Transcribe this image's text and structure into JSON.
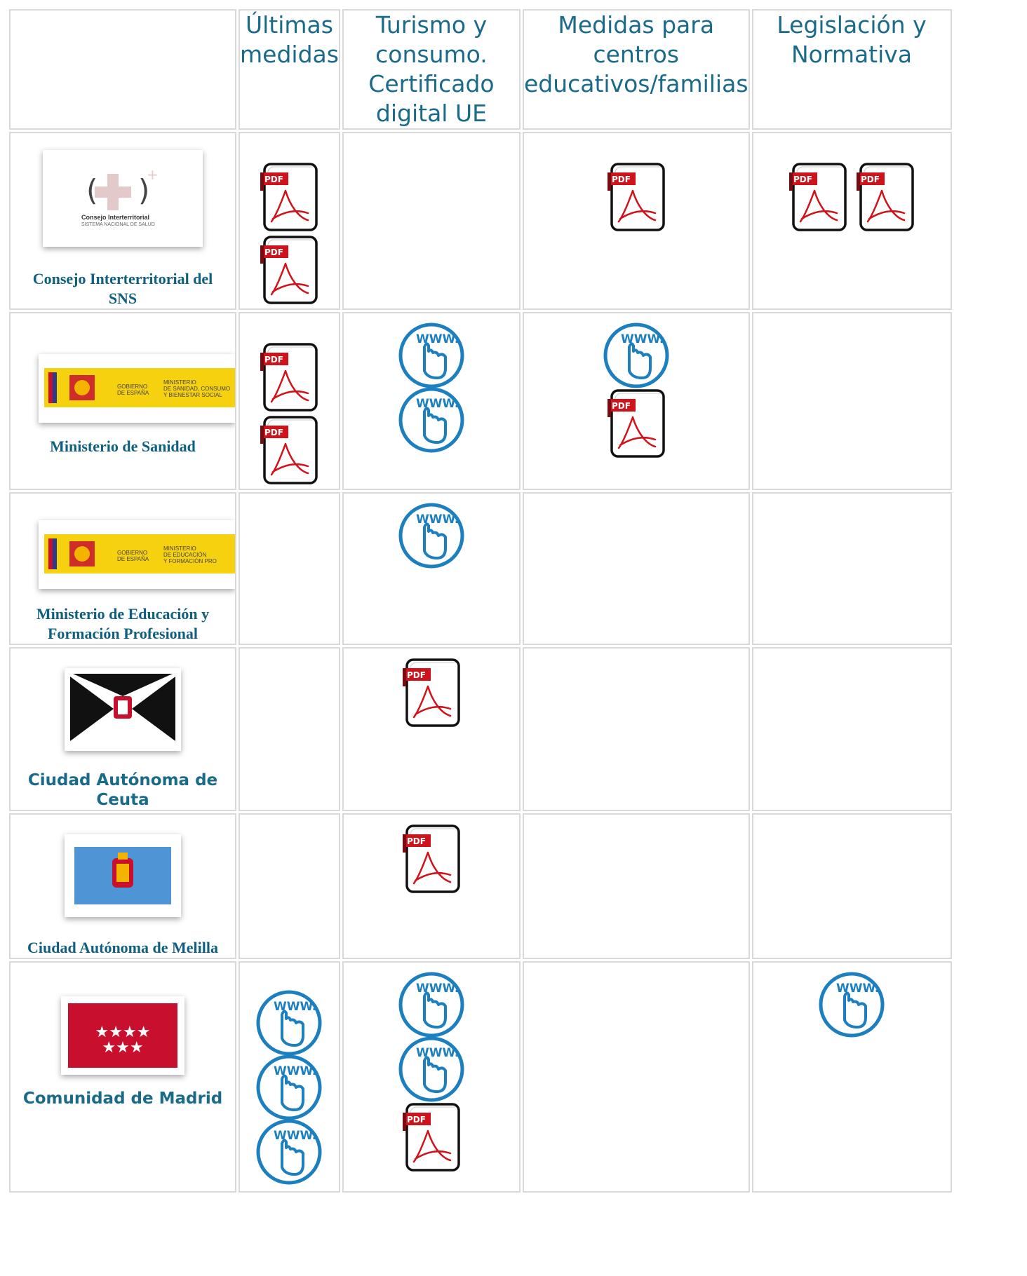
{
  "headers": [
    "Últimas medidas",
    "Turismo y consumo. Certificado digital UE",
    "Medidas para centros educativos/familias",
    "Legislación y Normativa"
  ],
  "icon_labels": {
    "pdf": "PDF",
    "www": "WWW."
  },
  "rows": [
    {
      "name": "Consejo Interterritorial del SNS",
      "logo": {
        "line1": "Consejo Interterritorial",
        "line2": "SISTEMA NACIONAL DE SALUD"
      },
      "cells": [
        [
          "pdf",
          "pdf"
        ],
        [],
        [
          "pdf"
        ],
        [
          "pdf",
          "pdf"
        ]
      ]
    },
    {
      "name": "Ministerio de Sanidad",
      "logo": {
        "gob": "GOBIERNO DE ESPAÑA",
        "min1": "MINISTERIO",
        "min2": "DE SANIDAD, CONSUMO",
        "min3": "Y BIENESTAR SOCIAL"
      },
      "cells": [
        [
          "pdf",
          "pdf"
        ],
        [
          "www",
          "www"
        ],
        [
          "www",
          "pdf"
        ],
        []
      ]
    },
    {
      "name": "Ministerio de Educación y Formación Profesional",
      "logo": {
        "gob": "GOBIERNO DE ESPAÑA",
        "min1": "MINISTERIO",
        "min2": "DE EDUCACIÓN",
        "min3": "Y FORMACIÓN PRO"
      },
      "cells": [
        [],
        [
          "www"
        ],
        [],
        []
      ]
    },
    {
      "name": "Ciudad Autónoma de Ceuta",
      "cells": [
        [],
        [
          "pdf"
        ],
        [],
        []
      ]
    },
    {
      "name": "Ciudad Autónoma de Melilla",
      "cells": [
        [],
        [
          "pdf"
        ],
        [],
        []
      ]
    },
    {
      "name": "Comunidad de Madrid",
      "cells": [
        [
          "www",
          "www",
          "www"
        ],
        [
          "www",
          "www",
          "pdf"
        ],
        [],
        [
          "www"
        ]
      ]
    }
  ],
  "colors": {
    "heading": "#1a6b8a",
    "entity": "#0f5f80",
    "pdf_red": "#d0121b",
    "www_blue": "#1b7fc0",
    "madrid_red": "#c8102e",
    "melilla_blue": "#4f94d4",
    "spain_yellow": "#f6d10f"
  }
}
